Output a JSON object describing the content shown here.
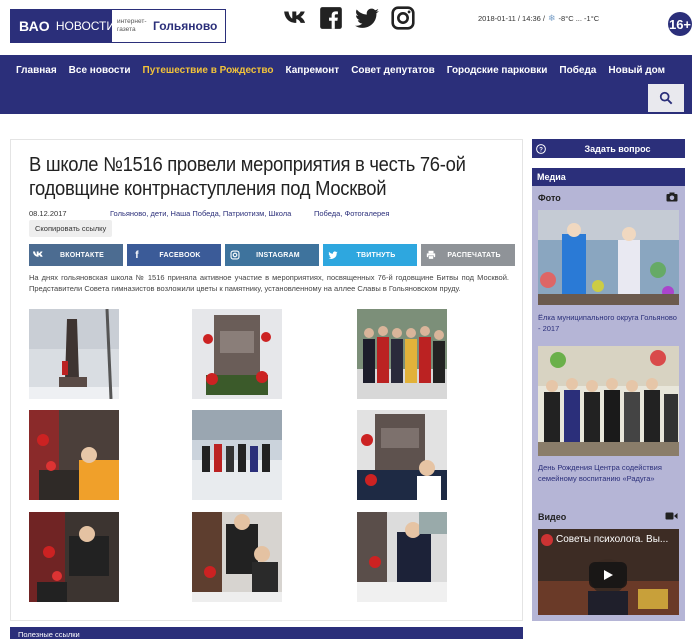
{
  "header": {
    "logo": {
      "vao": "ВАО",
      "news": "НОВОСТИ",
      "sub": "интернет-газета",
      "district": "Гольяново"
    },
    "socials": [
      {
        "icon": "vk-icon"
      },
      {
        "icon": "facebook-icon"
      },
      {
        "icon": "twitter-icon"
      },
      {
        "icon": "instagram-icon"
      }
    ],
    "datetime": "2018-01-11 / 14:36 /",
    "weather": "-8°C ... -1°C",
    "age_rating": "16+"
  },
  "nav": {
    "items": [
      "Главная",
      "Все новости",
      "Путешествие в Рождество",
      "Капремонт",
      "Совет депутатов",
      "Городские парковки",
      "Победа",
      "Новый дом"
    ],
    "active": "Путешествие в Рождество"
  },
  "article": {
    "title": "В школе №1516 провели мероприятия в честь 76-ой годовщине контрнаступления под Москвой",
    "date": "08.12.2017",
    "tags": "Гольяново, дети, Наша Победа, Патриотизм, Школа",
    "categories": "Победа, Фотогалерея",
    "copy_label": "Скопировать ссылку",
    "share": [
      {
        "label": "ВКОНТАКТЕ",
        "icon": "vk-icon"
      },
      {
        "label": "FACEBOOK",
        "icon": "facebook-icon"
      },
      {
        "label": "INSTAGRAM",
        "icon": "instagram-icon"
      },
      {
        "label": "ТВИТНУТЬ",
        "icon": "twitter-icon"
      },
      {
        "label": "РАСПЕЧАТАТЬ",
        "icon": "print-icon"
      }
    ],
    "lead": "На днях гольяновская школа № 1516 приняла активное участие в мероприятиях, посвященных 76-й годовщине Битвы под Москвой. Представители Совета гимназистов возложили цветы к памятнику, установленному на аллее Славы в Гольяновском пруду."
  },
  "sidebar": {
    "ask_label": "Задать вопрос",
    "media_title": "Медиа",
    "photo_label": "Фото",
    "captions": [
      "Ёлка муниципального округа Гольяново - 2017",
      "День Рождения Центра содействия семейному воспитанию «Радуга»"
    ],
    "video_label": "Видео",
    "video_title": "Советы психолога. Вы..."
  },
  "related_label": "Полезные ссылки",
  "colors": {
    "brand": "#2b2f7a",
    "accent": "#f2c33a",
    "sidebar": "#b5b5d6"
  }
}
